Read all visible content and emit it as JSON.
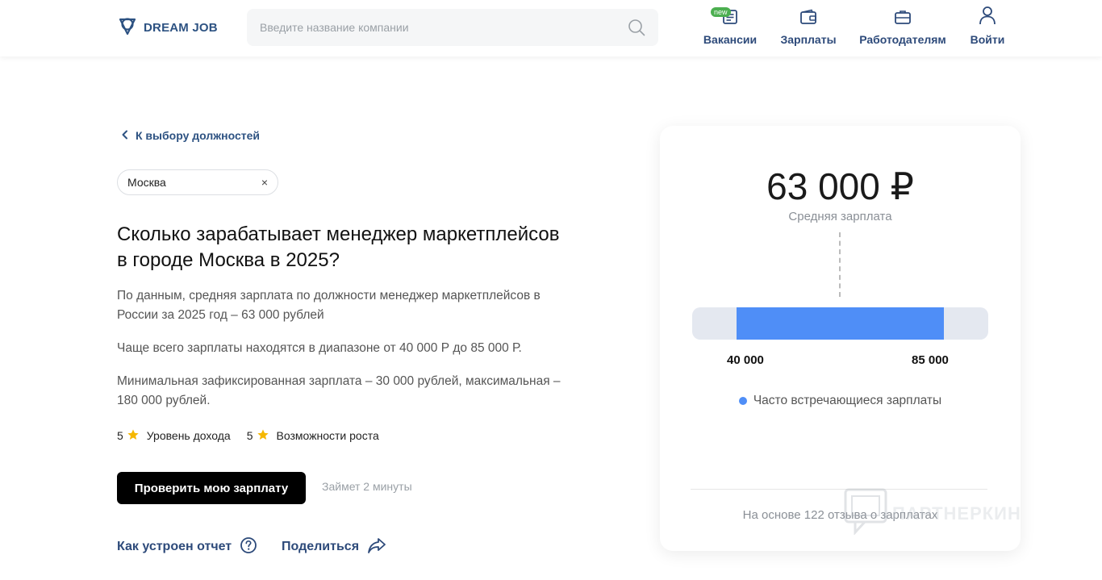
{
  "header": {
    "logo_text": "DREAM JOB",
    "search_placeholder": "Введите название компании",
    "nav": [
      {
        "label": "Вакансии",
        "badge": "new"
      },
      {
        "label": "Зарплаты"
      },
      {
        "label": "Работодателям"
      },
      {
        "label": "Войти"
      }
    ]
  },
  "main": {
    "back_link": "К выбору должностей",
    "city_chip": "Москва",
    "city_chip_clear": "×",
    "title": "Сколько зарабатывает менеджер маркетплейсов в городе Москва в 2025?",
    "paragraphs": [
      "По данным, средняя зарплата по должности менеджер маркетплейсов в России за 2025 год – 63 000 рублей",
      "Чаще всего зарплаты находятся в диапазоне от 40 000 Р до 85 000 Р.",
      "Минимальная зафиксированная зарплата – 30 000 рублей, максимальная – 180 000 рублей."
    ],
    "ratings": [
      {
        "value": "5",
        "label": "Уровень дохода"
      },
      {
        "value": "5",
        "label": "Возможности роста"
      }
    ],
    "cta_label": "Проверить мою зарплату",
    "cta_hint": "Займет 2 минуты",
    "report_link": "Как устроен отчет",
    "share_link": "Поделиться"
  },
  "card": {
    "salary": "63 000 ₽",
    "salary_caption": "Средняя зарплата",
    "range_low_label": "40 000",
    "range_high_label": "85 000",
    "range_fill_start": 0.15,
    "range_fill_end": 0.85,
    "legend": "Часто встречающиеся зарплаты",
    "footer": "На основе 122 отзыва о зарплатах"
  },
  "watermark": "ПАРТНЕРКИН",
  "colors": {
    "brand": "#2d5282",
    "accent_bar": "#4f8ef7",
    "track": "#e4e8f0",
    "badge_new": "#4caf50",
    "star": "#f5b700"
  }
}
